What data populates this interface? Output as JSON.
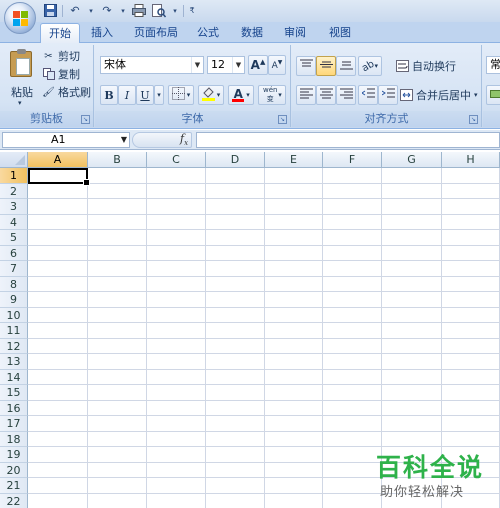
{
  "tabs": [
    {
      "label": "开始",
      "active": true
    },
    {
      "label": "插入"
    },
    {
      "label": "页面布局"
    },
    {
      "label": "公式"
    },
    {
      "label": "数据"
    },
    {
      "label": "审阅"
    },
    {
      "label": "视图"
    }
  ],
  "clipboard": {
    "paste": "粘贴",
    "cut": "剪切",
    "copy": "复制",
    "format_painter": "格式刷",
    "group_label": "剪贴板"
  },
  "font": {
    "name": "宋体",
    "size": "12",
    "bold": "B",
    "italic": "I",
    "underline": "U",
    "font_color_glyph": "A",
    "phonetic": "wén 变",
    "group_label": "字体"
  },
  "alignment": {
    "wrap_text": "自动换行",
    "merge_center": "合并后居中",
    "group_label": "对齐方式"
  },
  "number": {
    "format_partial": "常"
  },
  "formula_bar": {
    "name_box": "A1",
    "fx": "fx",
    "formula": ""
  },
  "sheet": {
    "columns": [
      "A",
      "B",
      "C",
      "D",
      "E",
      "F",
      "G",
      "H"
    ],
    "rows": [
      "1",
      "2",
      "3",
      "4",
      "5",
      "6",
      "7",
      "8",
      "9",
      "10",
      "11",
      "12",
      "13",
      "14",
      "15",
      "16",
      "17",
      "18",
      "19",
      "20",
      "21",
      "22"
    ],
    "selected_cell": "A1"
  },
  "watermark": {
    "title": "百科全说",
    "subtitle": "助你轻松解决"
  },
  "colors": {
    "ribbon_bg": "#d5e3f4",
    "tab_text": "#15428b",
    "selected_header": "#f1c15f",
    "gridline": "#d0d7e5",
    "watermark_green": "#2eb24a"
  }
}
